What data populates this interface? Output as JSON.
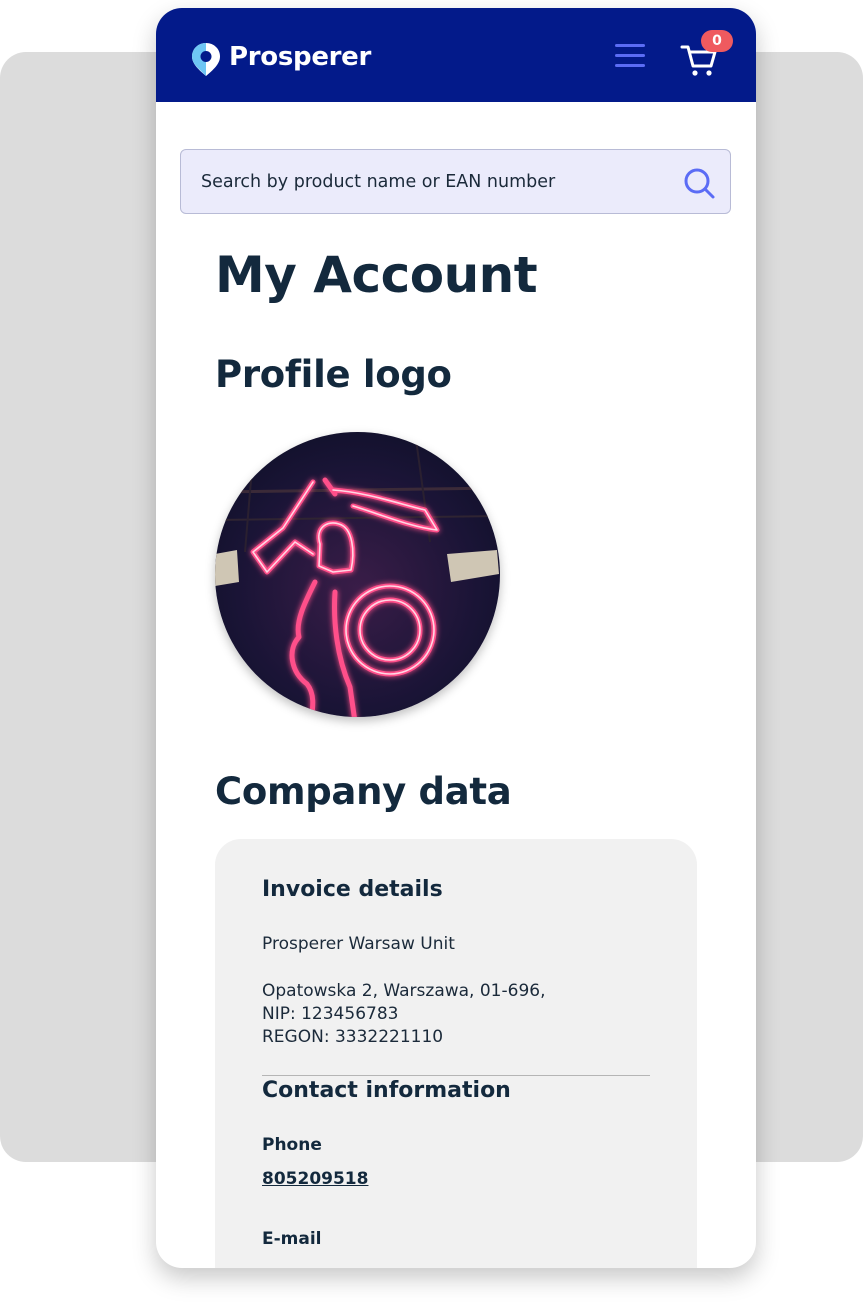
{
  "header": {
    "brand": "Prosperer",
    "cart_count": "0"
  },
  "search": {
    "placeholder": "Search by product name or EAN number"
  },
  "page_title": "My Account",
  "profile": {
    "heading": "Profile logo"
  },
  "company": {
    "heading": "Company data",
    "invoice": {
      "title": "Invoice details",
      "name": "Prosperer Warsaw Unit",
      "address": "Opatowska 2, Warszawa, 01-696,",
      "nip": "NIP: 123456783",
      "regon": "REGON: 3332221110"
    },
    "contact": {
      "title": "Contact information",
      "phone_label": "Phone",
      "phone_value": "805209518",
      "email_label": "E-mail"
    }
  },
  "colors": {
    "navbar": "#031a8a",
    "accent": "#5b6cf5",
    "badge": "#ef5a5f",
    "search_bg": "#ebebfb",
    "card_bg": "#f1f1f1",
    "heading_text": "#13293d"
  },
  "icons": [
    "location-pin-logo-icon",
    "hamburger-menu-icon",
    "shopping-cart-icon",
    "search-icon"
  ]
}
